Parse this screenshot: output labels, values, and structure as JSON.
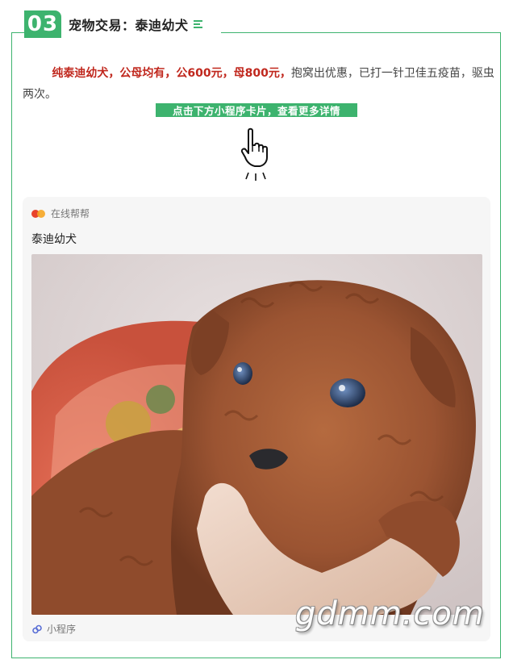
{
  "section": {
    "number": "03",
    "title": "宠物交易：泰迪幼犬"
  },
  "description": {
    "highlight": "纯泰迪幼犬，公母均有，公600元，母800元，",
    "rest": "抱窝出优惠，已打一针卫佳五疫苗，驱虫两次。"
  },
  "cta": "点击下方小程序卡片，查看更多详情",
  "card": {
    "source": "在线帮帮",
    "title": "泰迪幼犬",
    "footer_label": "小程序",
    "icon_names": [
      "app-logo-icon",
      "mini-program-link-icon"
    ]
  },
  "watermark": "gdmm.com",
  "colors": {
    "accent": "#3db36e",
    "highlight_text": "#c0271d",
    "card_bg": "#f6f6f6"
  }
}
